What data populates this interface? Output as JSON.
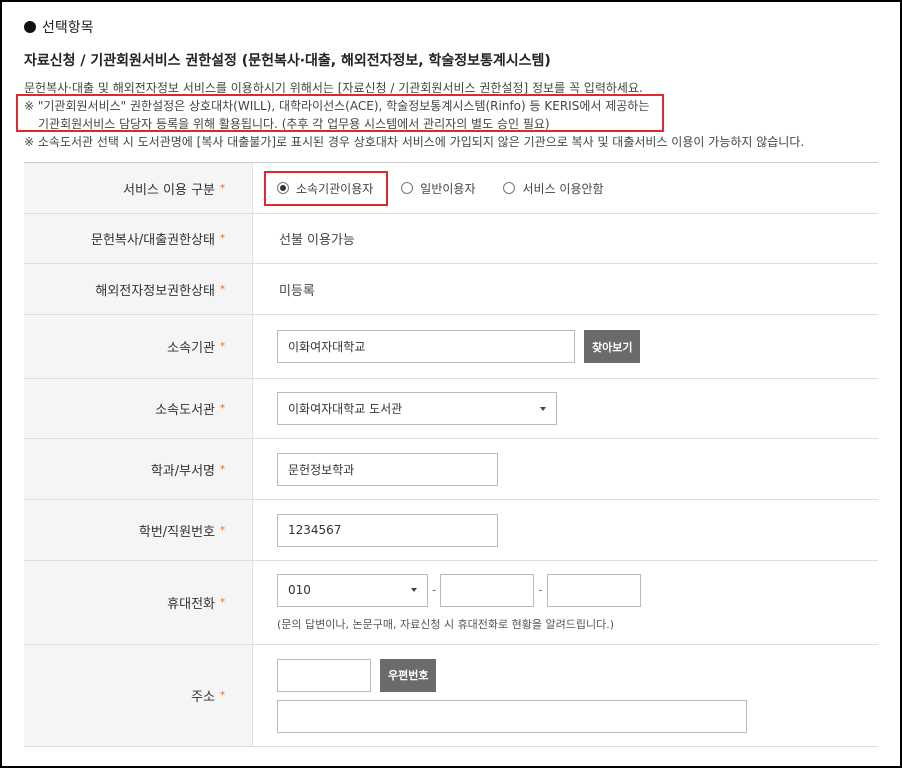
{
  "section": {
    "title": "선택항목",
    "subtitle": "자료신청 / 기관회원서비스 권한설정 (문헌복사·대출, 해외전자정보, 학술정보통계시스템)"
  },
  "notes": [
    "문헌복사·대출 및 해외전자정보 서비스를 이용하시기 위해서는 [자료신청 / 기관회원서비스 권한설정] 정보를 꼭 입력하세요.",
    "※ \"기관회원서비스\" 권한설정은 상호대차(WILL), 대학라이선스(ACE), 학술정보통계시스템(Rinfo) 등 KERIS에서 제공하는",
    "기관회원서비스 담당자 등록을 위해 활용됩니다. (추후 각 업무용 시스템에서 관리자의 별도 승인 필요)",
    "※ 소속도서관 선택 시 도서관명에 [복사 대출불가]로 표시된 경우 상호대차 서비스에 가입되지 않은 기관으로 복사 및 대출서비스 이용이 가능하지 않습니다."
  ],
  "form": {
    "required_mark": "*",
    "service_type": {
      "label": "서비스 이용 구분",
      "options": [
        "소속기관이용자",
        "일반이용자",
        "서비스 이용안함"
      ],
      "selected": "소속기관이용자"
    },
    "copy_loan_status": {
      "label": "문헌복사/대출권한상태",
      "value": "선불 이용가능"
    },
    "overseas_status": {
      "label": "해외전자정보권한상태",
      "value": "미등록"
    },
    "institution": {
      "label": "소속기관",
      "value": "이화여자대학교",
      "button": "찾아보기"
    },
    "library": {
      "label": "소속도서관",
      "value": "이화여자대학교 도서관"
    },
    "department": {
      "label": "학과/부서명",
      "value": "문헌정보학과"
    },
    "student_id": {
      "label": "학번/직원번호",
      "value": "1234567"
    },
    "mobile": {
      "label": "휴대전화",
      "prefix": "010",
      "dash": "-",
      "help": "(문의 답변이나, 논문구매, 자료신청 시 휴대전화로 현황을 알려드립니다.)"
    },
    "address": {
      "label": "주소",
      "button": "우편번호"
    }
  }
}
